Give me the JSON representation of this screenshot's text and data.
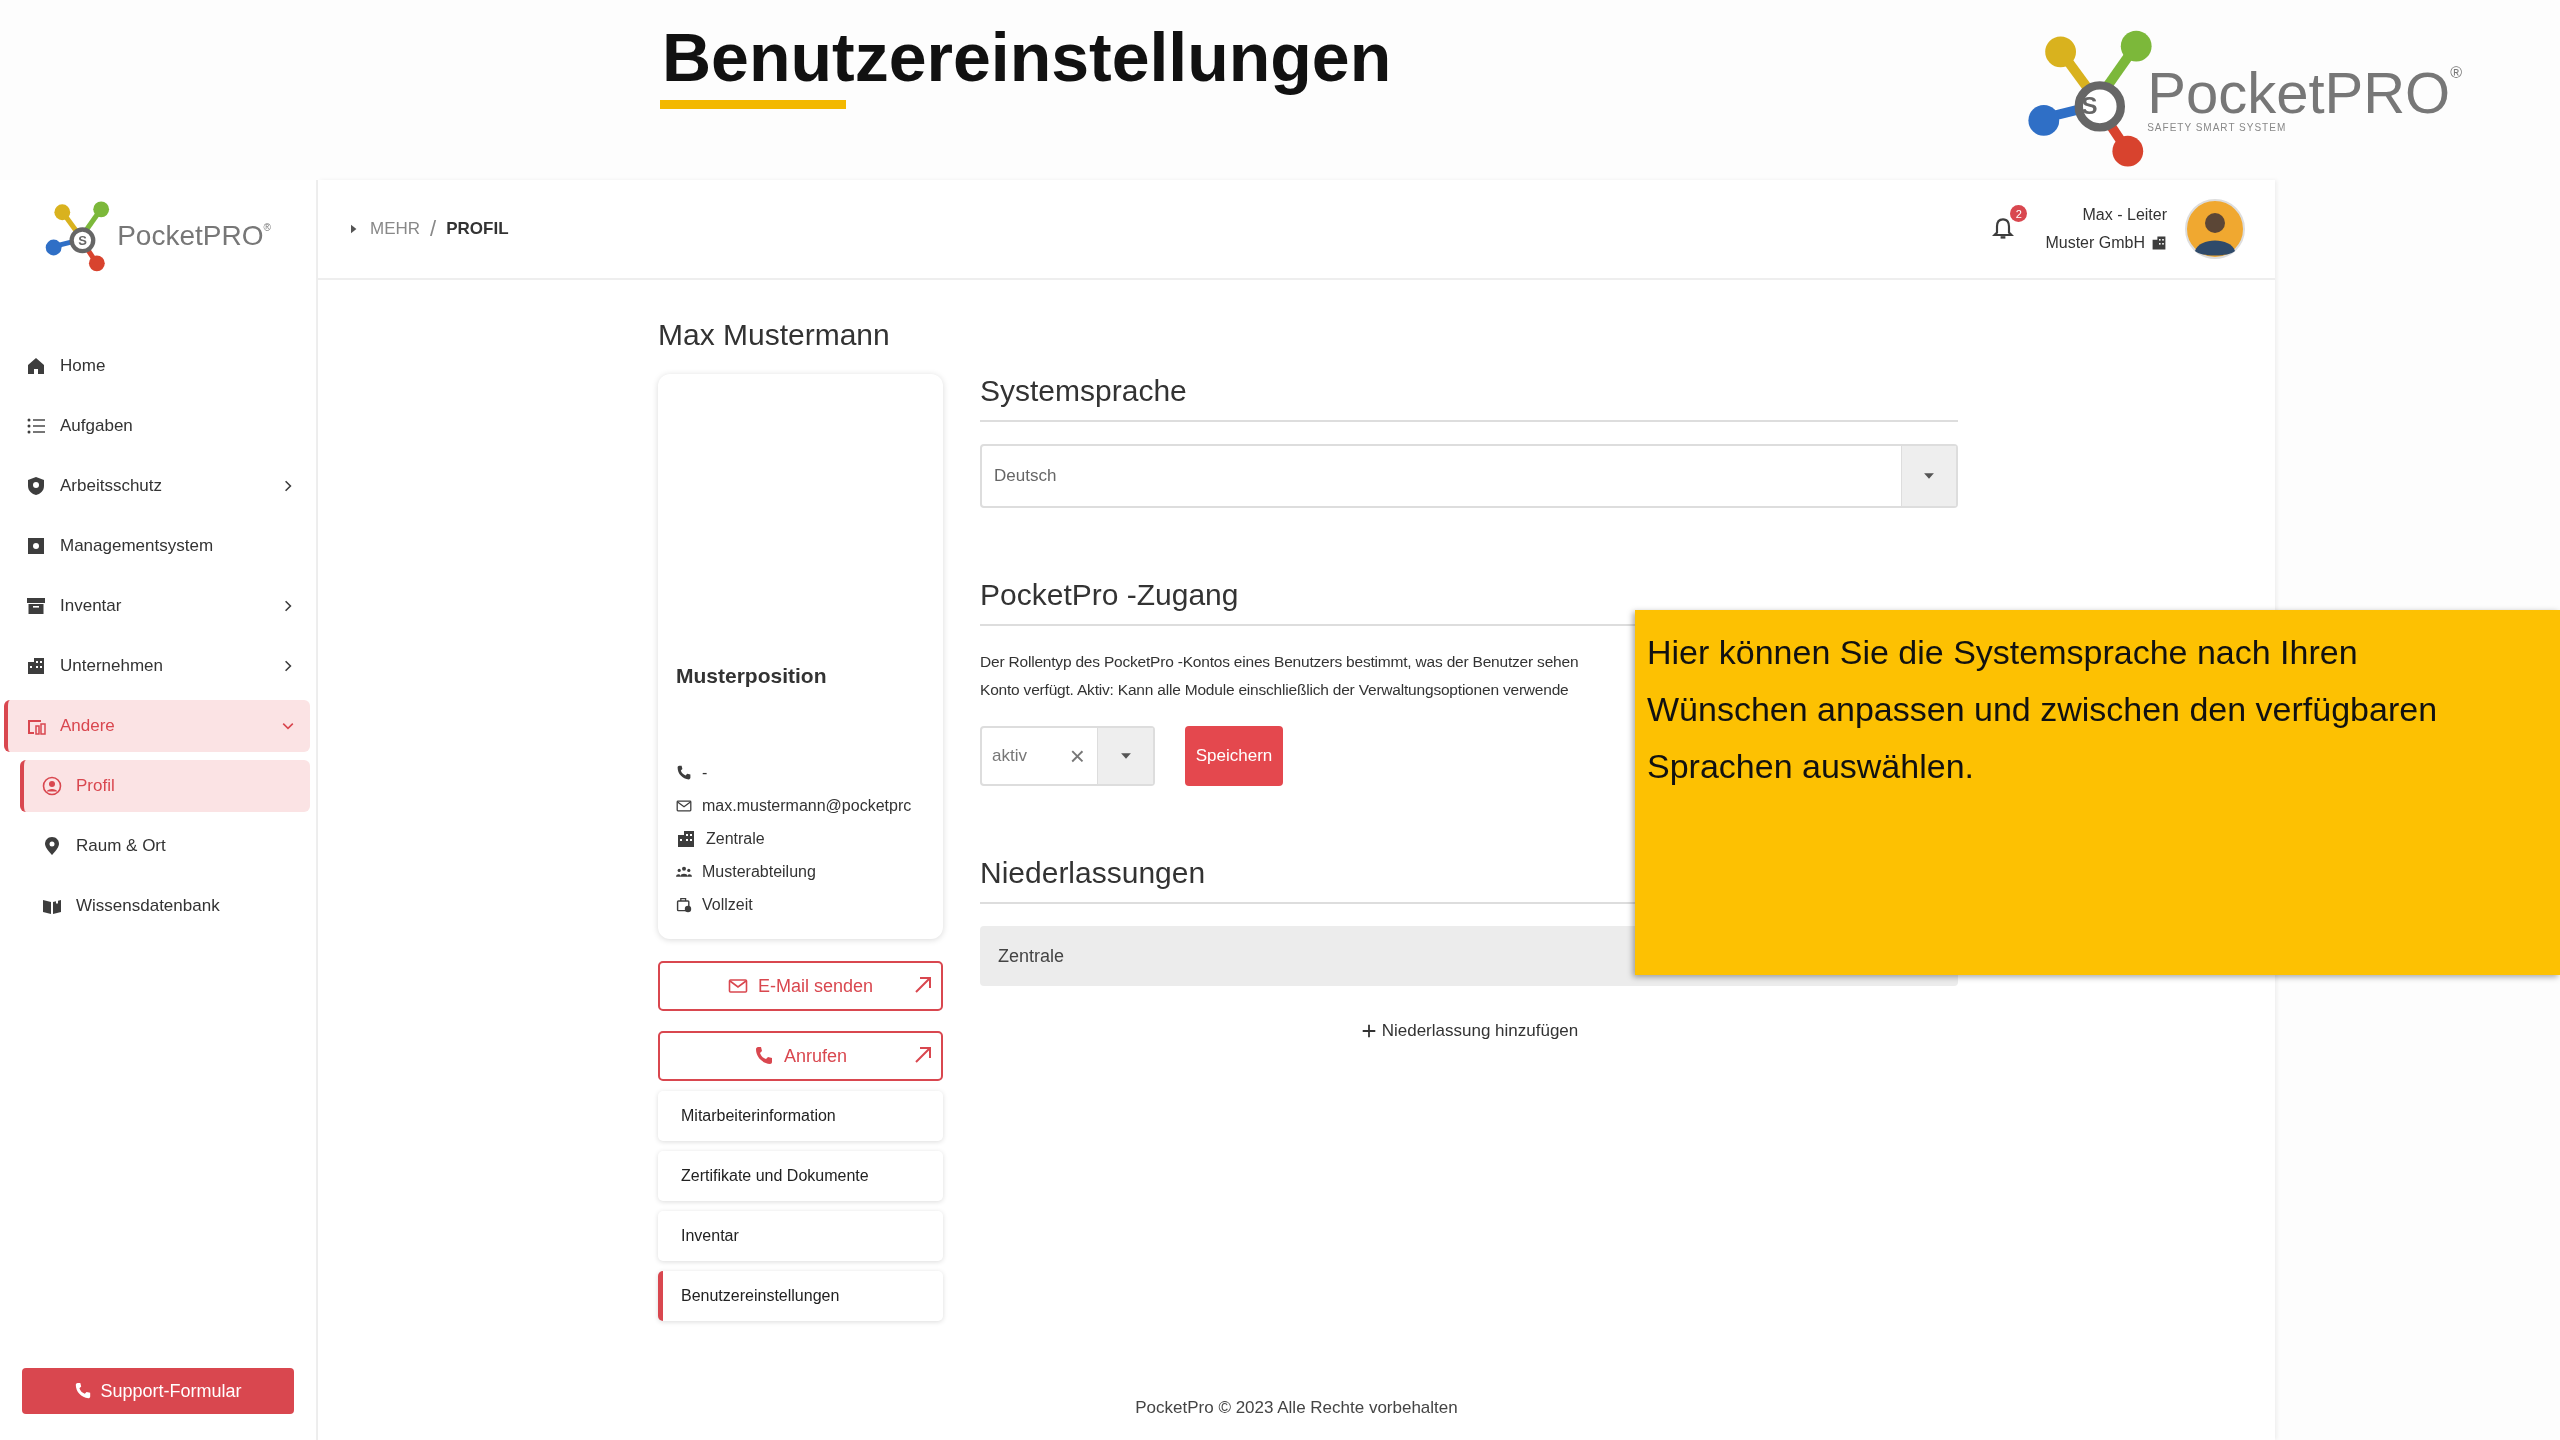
{
  "slide": {
    "title": "Benutzereinstellungen",
    "logo": {
      "symbol": "S",
      "name": "PocketPRO",
      "mark": "®",
      "tagline": "SAFETY SMART SYSTEM"
    }
  },
  "sidebar": {
    "logo": {
      "symbol": "S",
      "name": "PocketPRO",
      "mark": "®"
    },
    "items": [
      {
        "label": "Home",
        "selected": false
      },
      {
        "label": "Aufgaben",
        "selected": false
      },
      {
        "label": "Arbeitsschutz",
        "selected": false,
        "expanded": false
      },
      {
        "label": "Managementsystem",
        "selected": false
      },
      {
        "label": "Inventar",
        "selected": false,
        "expanded": false
      },
      {
        "label": "Unternehmen",
        "selected": false,
        "expanded": false
      },
      {
        "label": "Andere",
        "selected": true,
        "expanded": true,
        "children": [
          {
            "label": "Profil",
            "selected": true
          },
          {
            "label": "Raum & Ort",
            "selected": false
          },
          {
            "label": "Wissensdatenbank",
            "selected": false
          }
        ]
      }
    ],
    "support_button": "Support-Formular"
  },
  "header": {
    "breadcrumb": [
      {
        "label": "MEHR",
        "selected": false
      },
      {
        "label": "PROFIL",
        "selected": true
      }
    ],
    "separator": "/",
    "notifications": "2",
    "user_name": "Max - Leiter",
    "company": "Muster GmbH"
  },
  "profile": {
    "name": "Max Mustermann",
    "position": "Musterposition",
    "details": [
      "-",
      "max.mustermann@pocketprc",
      "Zentrale",
      "Musterabteilung",
      "Vollzeit"
    ],
    "actions": [
      "E-Mail senden",
      "Anrufen"
    ],
    "menu": [
      {
        "label": "Mitarbeiterinformation",
        "selected": false
      },
      {
        "label": "Zertifikate und Dokumente",
        "selected": false
      },
      {
        "label": "Inventar",
        "selected": false
      },
      {
        "label": "Benutzereinstellungen",
        "selected": true
      }
    ]
  },
  "settings": {
    "language": {
      "heading": "Systemsprache",
      "value": "Deutsch"
    },
    "access": {
      "heading": "PocketPro -Zugang",
      "description": [
        "Der Rollentyp des PocketPro -Kontos eines Benutzers bestimmt, was der Benutzer sehen",
        "Konto verfügt. Aktiv: Kann alle Module einschließlich der Verwaltungsoptionen verwende"
      ],
      "role": "aktiv",
      "clear": "×",
      "save_button": "Speichern"
    },
    "branches": {
      "heading": "Niederlassungen",
      "items": [
        "Zentrale"
      ],
      "add_link": "Niederlassung hinzufügen"
    }
  },
  "footer": "PocketPro © 2023 Alle Rechte vorbehalten",
  "callout": "Hier können Sie die Systemsprache nach Ihren Wünschen anpassen und zwischen den verfügbaren Sprachen auswählen."
}
